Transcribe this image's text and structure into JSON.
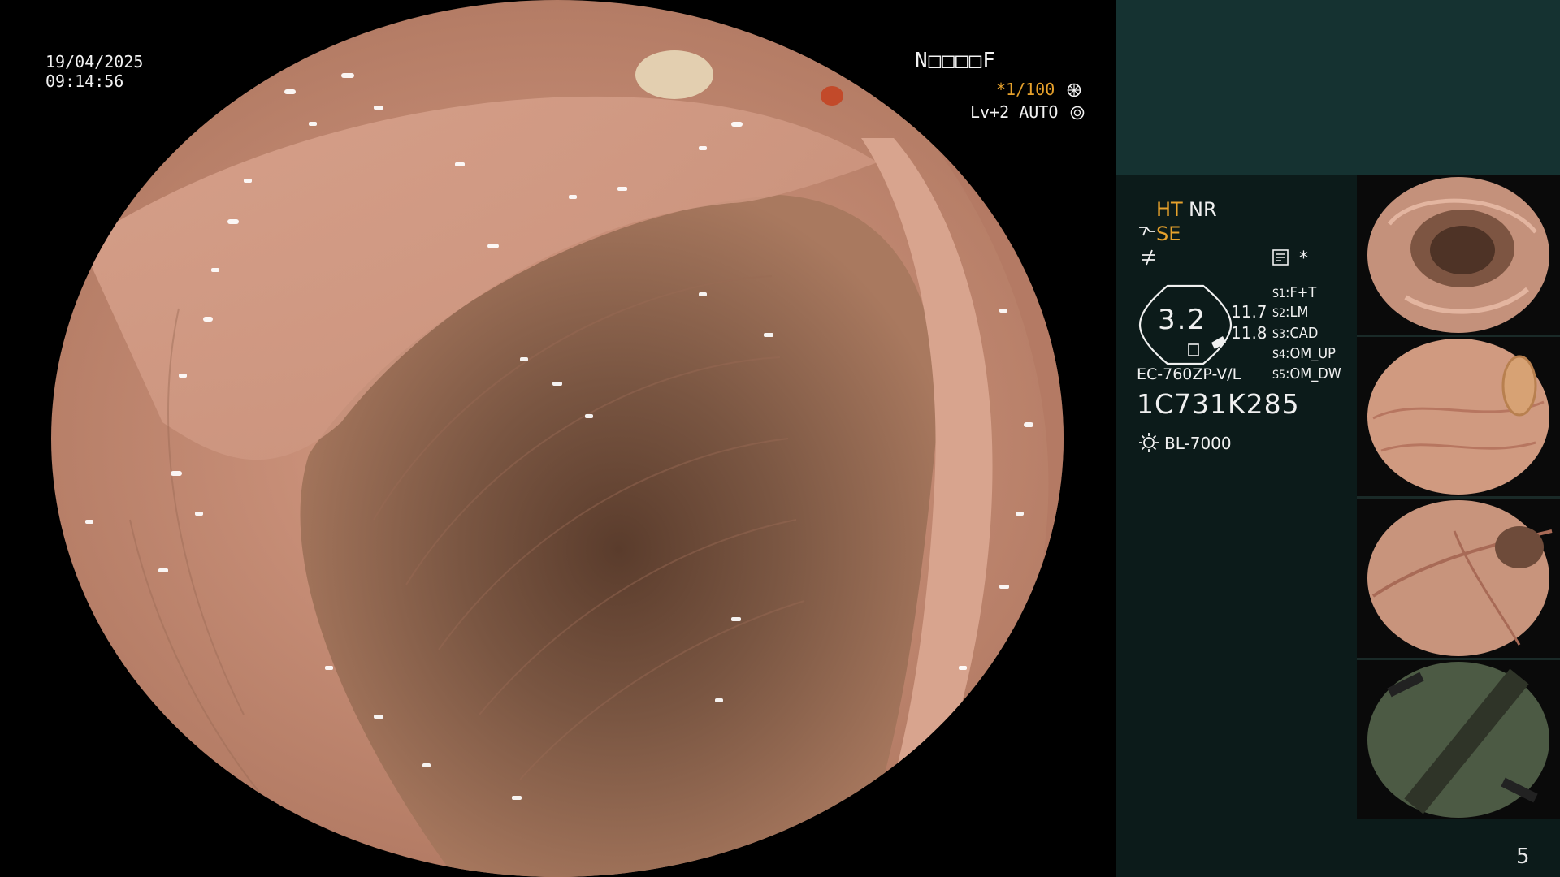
{
  "overlay": {
    "date": "19/04/2025",
    "time": "09:14:56",
    "patient_id": "N□□□□F",
    "shutter": "*1/100",
    "light_level": "Lv+2 AUTO"
  },
  "panel": {
    "ht": "HT",
    "nr": "NR",
    "se": "SE",
    "star": "*",
    "zoom": "3.2",
    "value_a": "11.7",
    "value_b": "11.8",
    "switches": [
      {
        "key": "S1",
        "value": "F+T"
      },
      {
        "key": "S2",
        "value": "LM"
      },
      {
        "key": "S3",
        "value": "CAD"
      },
      {
        "key": "S4",
        "value": "OM_UP"
      },
      {
        "key": "S5",
        "value": "OM_DW"
      }
    ],
    "scope_model": "EC-760ZP-V/L",
    "serial": "1C731K285",
    "light_source": "BL-7000",
    "page_number": "5"
  },
  "colors": {
    "panel_bg": "#0c1b1a",
    "panel_top": "#153231",
    "accent": "#e6a12c",
    "tissue": "#c99078",
    "lumen": "#6a4a38"
  },
  "icons": [
    "settings-icon",
    "iris-icon",
    "scissors-icon",
    "function-icon",
    "memo-icon",
    "lamp-icon"
  ]
}
